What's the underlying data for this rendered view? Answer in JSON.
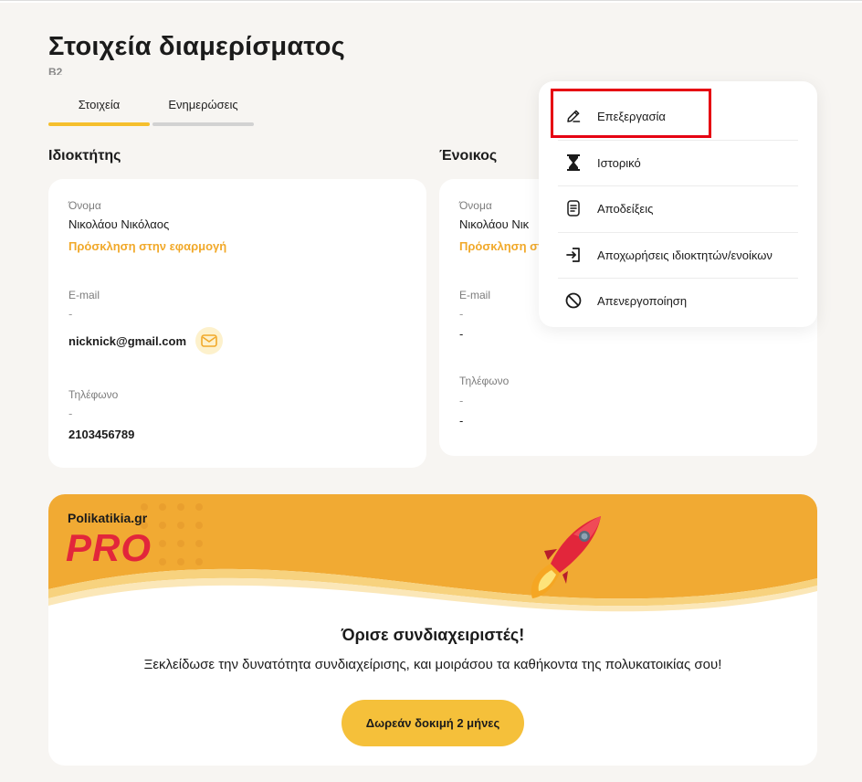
{
  "page": {
    "title": "Στοιχεία διαμερίσματος",
    "subtitle": "B2"
  },
  "tabs": [
    {
      "label": "Στοιχεία",
      "active": true
    },
    {
      "label": "Ενημερώσεις",
      "active": false
    }
  ],
  "owner": {
    "section_title": "Ιδιοκτήτης",
    "name_label": "Όνομα",
    "name": "Νικολάου Νικόλαος",
    "invite_link": "Πρόσκληση στην εφαρμογή",
    "email_label": "E-mail",
    "email_placeholder": "-",
    "email": "nicknick@gmail.com",
    "phone_label": "Τηλέφωνο",
    "phone_placeholder": "-",
    "phone": "2103456789"
  },
  "tenant": {
    "section_title": "Ένοικος",
    "name_label": "Όνομα",
    "name": "Νικολάου Νικ",
    "invite_link": "Πρόσκληση στ",
    "email_label": "E-mail",
    "email_placeholder": "-",
    "email": "-",
    "phone_label": "Τηλέφωνο",
    "phone_placeholder": "-",
    "phone": "-"
  },
  "menu": {
    "items": [
      {
        "label": "Επεξεργασία",
        "icon": "edit-icon"
      },
      {
        "label": "Ιστορικό",
        "icon": "hourglass-icon"
      },
      {
        "label": "Αποδείξεις",
        "icon": "receipt-icon"
      },
      {
        "label": "Αποχωρήσεις ιδιοκτητών/ενοίκων",
        "icon": "exit-icon"
      },
      {
        "label": "Απενεργοποίηση",
        "icon": "block-icon"
      }
    ],
    "highlighted_item": "Επεξεργασία"
  },
  "promo": {
    "brand": "Polikatikia.gr",
    "badge": "PRO",
    "heading": "Όρισε συνδιαχειριστές!",
    "text": "Ξεκλείδωσε την δυνατότητα συνδιαχείρισης, και μοιράσου τα καθήκοντα της πολυκατοικίας  σου!",
    "button": "Δωρεάν δοκιμή 2 μήνες"
  },
  "colors": {
    "accent": "#f5bf2d",
    "link": "#f1a92a",
    "promo_banner": "#f1aa33",
    "pro_red": "#e2263b",
    "highlight": "#e60012"
  }
}
